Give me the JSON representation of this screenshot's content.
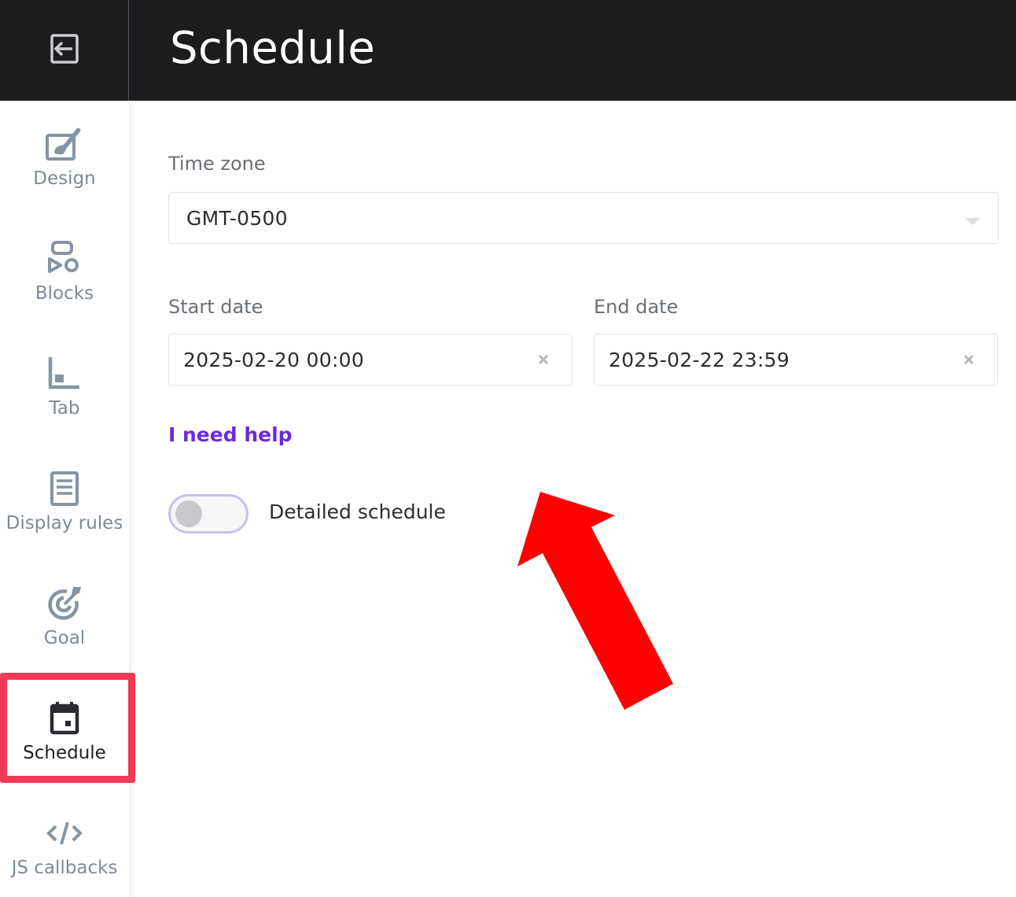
{
  "header": {
    "title": "Schedule",
    "back_icon": "exit-icon"
  },
  "sidebar": {
    "items": [
      {
        "label": "Design",
        "icon": "design-icon"
      },
      {
        "label": "Blocks",
        "icon": "blocks-icon"
      },
      {
        "label": "Tab",
        "icon": "tab-icon"
      },
      {
        "label": "Display rules",
        "icon": "display-rules-icon"
      },
      {
        "label": "Goal",
        "icon": "goal-icon"
      },
      {
        "label": "Schedule",
        "icon": "calendar-icon",
        "active": true
      },
      {
        "label": "JS callbacks",
        "icon": "code-icon"
      }
    ]
  },
  "form": {
    "timezone_label": "Time zone",
    "timezone_value": "GMT-0500",
    "start_label": "Start date",
    "start_value": "2025-02-20 00:00",
    "end_label": "End date",
    "end_value": "2025-02-22 23:59",
    "help_link": "I need help",
    "toggle_label": "Detailed schedule",
    "toggle_on": false
  },
  "colors": {
    "header_bg": "#1c1c1e",
    "accent": "#6b2bd9",
    "highlight": "#ef3b55",
    "annotation_arrow": "#ff0000",
    "sidebar_icon": "#7d8a97"
  }
}
